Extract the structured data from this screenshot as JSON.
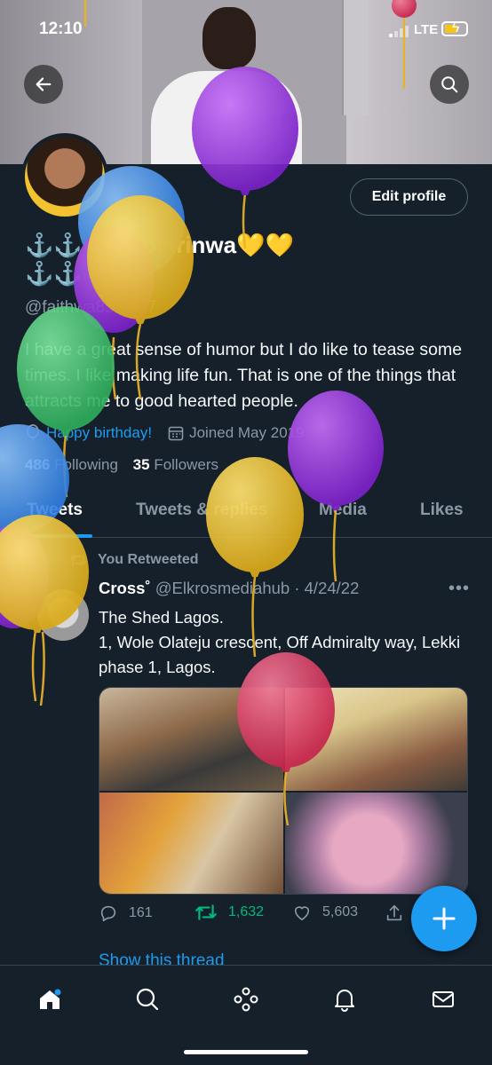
{
  "status_bar": {
    "time": "12:10",
    "network": "LTE"
  },
  "profile": {
    "edit_button": "Edit profile",
    "display_name": "⚓⚓ oal bolarinwa💛💛",
    "display_name_line2": "⚓⚓",
    "handle": "@faithwa85 3607",
    "bio": "I have a great sense of humor but I do like to tease some times. I like making life fun. That is one of the things that attracts me to good hearted people.",
    "birthday": "Happy birthday!",
    "joined": "Joined May 2019",
    "following_count": "486",
    "following_label": "Following",
    "followers_count": "35",
    "followers_label": "Followers"
  },
  "tabs": [
    {
      "label": "Tweets",
      "active": true
    },
    {
      "label": "Tweets & replies",
      "active": false
    },
    {
      "label": "Media",
      "active": false
    },
    {
      "label": "Likes",
      "active": false
    }
  ],
  "tweet": {
    "retweet_label": "You Retweeted",
    "author_name": "Cross˚",
    "author_handle": "@Elkrosmediahub",
    "date": "4/24/22",
    "text_line1": "The Shed Lagos.",
    "text_line2": "1, Wole Olateju crescent, Off Admiralty way, Lekki phase 1, Lagos.",
    "replies": "161",
    "retweets": "1,632",
    "likes": "5,603",
    "show_thread": "Show this thread"
  },
  "icons": {
    "back": "back-arrow-icon",
    "search": "search-icon",
    "nav": [
      "home-icon",
      "search-icon",
      "spaces-icon",
      "notifications-icon",
      "messages-icon"
    ],
    "fab": "plus-icon"
  },
  "colors": {
    "background": "#15202b",
    "accent": "#1d9bf0",
    "retweet": "#00ba7c",
    "muted": "#8b98a5"
  }
}
